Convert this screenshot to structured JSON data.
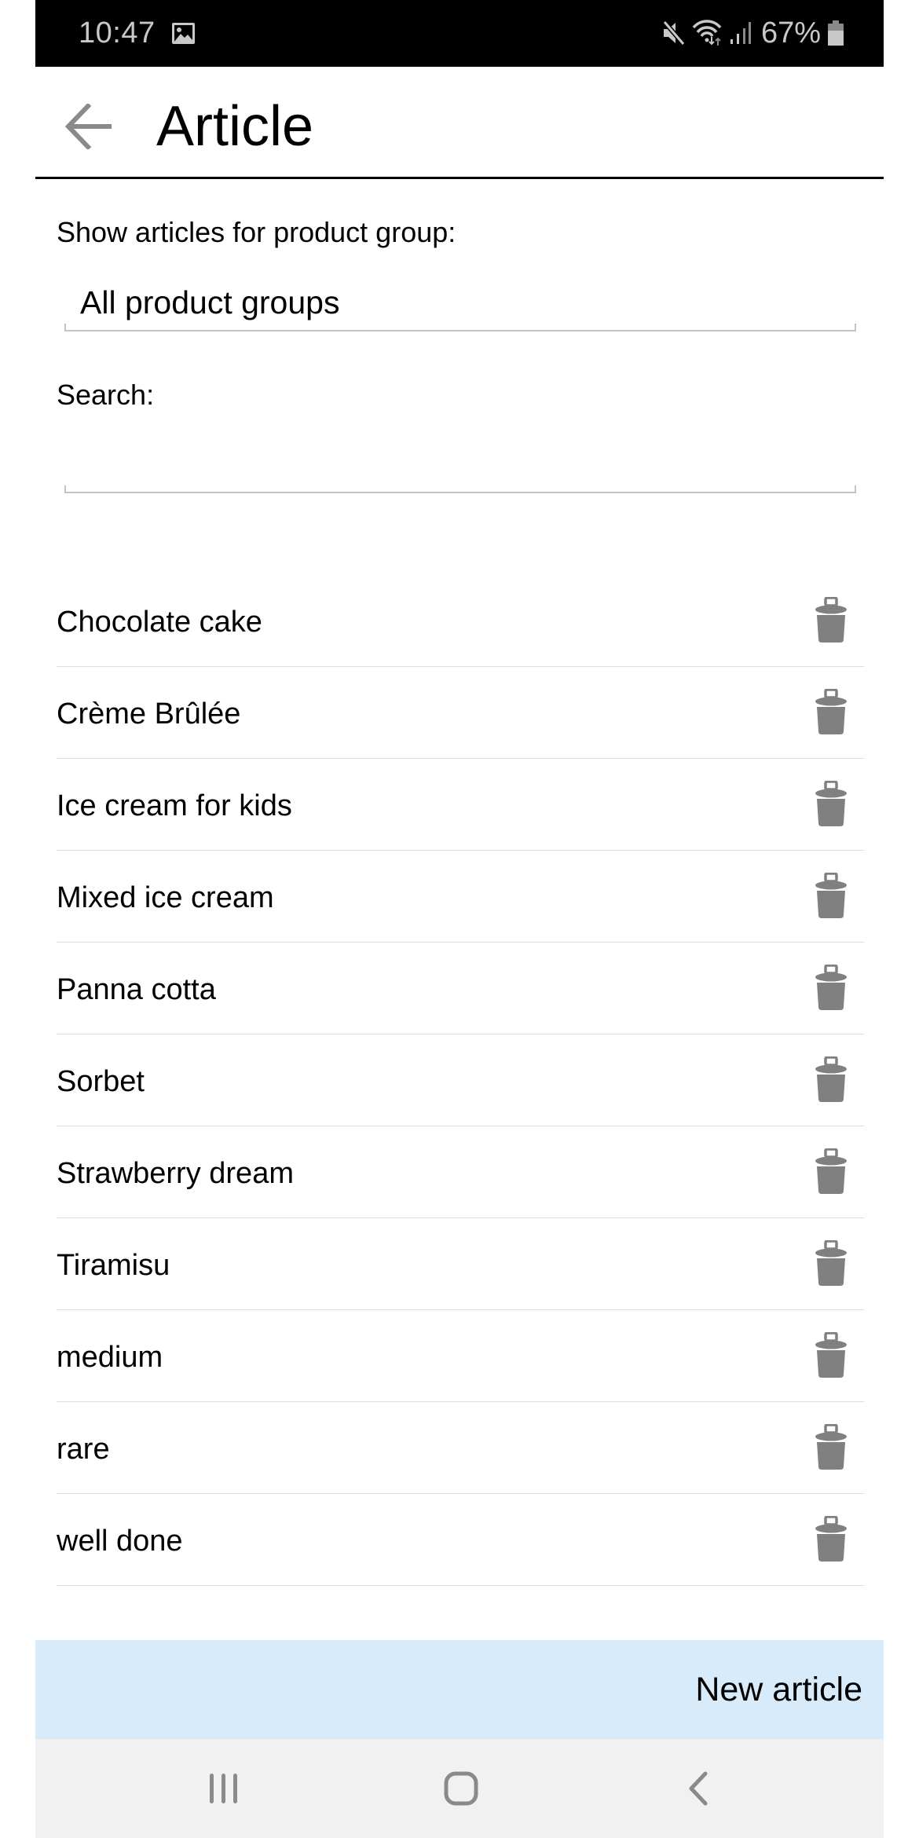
{
  "status_bar": {
    "time": "10:47",
    "battery_percent": "67%",
    "icons": [
      "gallery-notification-icon",
      "mute-icon",
      "wifi-icon",
      "signal-icon",
      "battery-icon"
    ]
  },
  "header": {
    "title": "Article",
    "back_icon": "arrow-left-icon"
  },
  "filter": {
    "label": "Show articles for product group:",
    "selected": "All product groups"
  },
  "search": {
    "label": "Search:",
    "value": "",
    "placeholder": ""
  },
  "articles": [
    {
      "name": "Chocolate cake"
    },
    {
      "name": "Crème Brûlée"
    },
    {
      "name": "Ice cream for kids"
    },
    {
      "name": "Mixed ice cream"
    },
    {
      "name": "Panna cotta"
    },
    {
      "name": "Sorbet"
    },
    {
      "name": "Strawberry dream"
    },
    {
      "name": "Tiramisu"
    },
    {
      "name": "medium"
    },
    {
      "name": "rare"
    },
    {
      "name": "well done"
    }
  ],
  "actions": {
    "new_article_label": "New article",
    "delete_icon": "trash-icon"
  },
  "nav_bar": {
    "buttons": [
      "recent-apps",
      "home",
      "back"
    ]
  },
  "colors": {
    "status_bar_bg": "#000000",
    "icon_gray": "#808080",
    "new_article_bg": "#d8ebfa",
    "nav_bar_bg": "#f1f1f1",
    "divider": "#dedede"
  }
}
